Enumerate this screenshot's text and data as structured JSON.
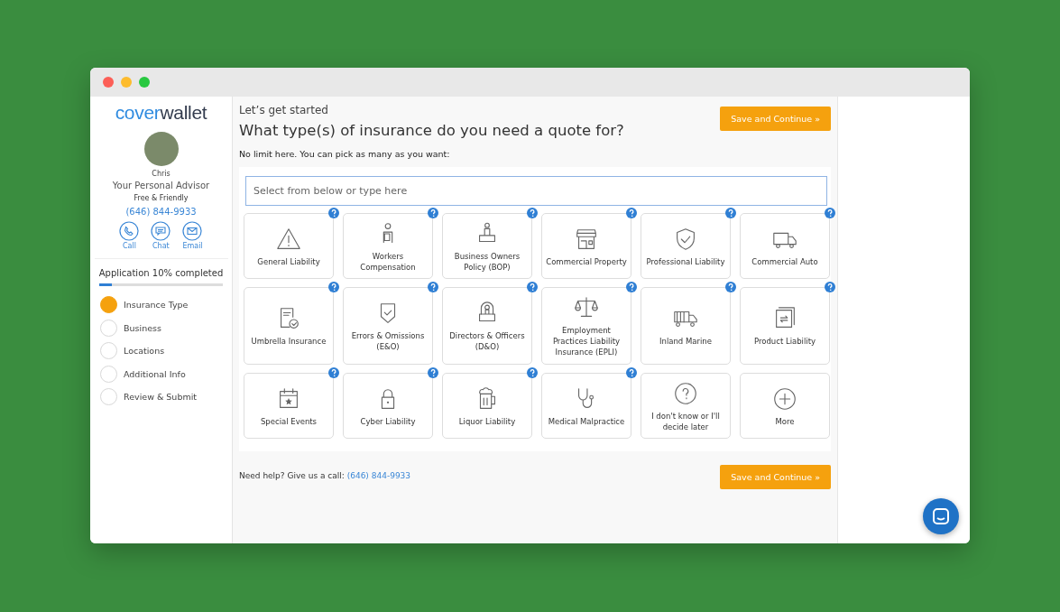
{
  "sidebar": {
    "logo": {
      "part_1": "cover",
      "part_2": "wallet"
    },
    "advisor": {
      "name": "Chris",
      "role": "Your Personal Advisor",
      "tagline": "Free & Friendly",
      "phone": "(646) 844-9933"
    },
    "contacts": [
      {
        "label": "Call"
      },
      {
        "label": "Chat"
      },
      {
        "label": "Email"
      }
    ],
    "progress": {
      "label": "Application 10% completed",
      "level": 0.1
    },
    "steps": [
      {
        "label": "Insurance Type",
        "current": true
      },
      {
        "label": "Business",
        "current": false
      },
      {
        "label": "Locations",
        "current": false
      },
      {
        "label": "Additional Info",
        "current": false
      },
      {
        "label": "Review & Submit",
        "current": false
      }
    ]
  },
  "main": {
    "eyebrow": "Let’s get started",
    "title": "What type(s) of insurance do you need a quote for?",
    "subtitle": "No limit here. You can pick as many as you want:",
    "primary_button": "Save and Continue »",
    "search": {
      "placeholder": "Select from below or type here"
    },
    "options": [
      {
        "label": "General Liability",
        "help": true
      },
      {
        "label": "Workers Compensation",
        "help": true
      },
      {
        "label": "Business Owners Policy (BOP)",
        "help": true
      },
      {
        "label": "Commercial Property",
        "help": true
      },
      {
        "label": "Professional Liability",
        "help": true
      },
      {
        "label": "Commercial Auto",
        "help": true
      },
      {
        "label": "Umbrella Insurance",
        "help": true
      },
      {
        "label": "Errors & Omissions (E&O)",
        "help": true
      },
      {
        "label": "Directors & Officers (D&O)",
        "help": true
      },
      {
        "label": "Employment Practices Liability Insurance (EPLI)",
        "help": true
      },
      {
        "label": "Inland Marine",
        "help": true
      },
      {
        "label": "Product Liability",
        "help": true
      },
      {
        "label": "Special Events",
        "help": true
      },
      {
        "label": "Cyber Liability",
        "help": true
      },
      {
        "label": "Liquor Liability",
        "help": true
      },
      {
        "label": "Medical Malpractice",
        "help": true
      },
      {
        "label": "I don't know or I'll decide later",
        "help": false
      },
      {
        "label": "More",
        "help": false
      }
    ],
    "footer": {
      "text": "Need help? Give us a call:",
      "phone": "(646) 844-9933",
      "button": "Save and Continue »"
    }
  }
}
